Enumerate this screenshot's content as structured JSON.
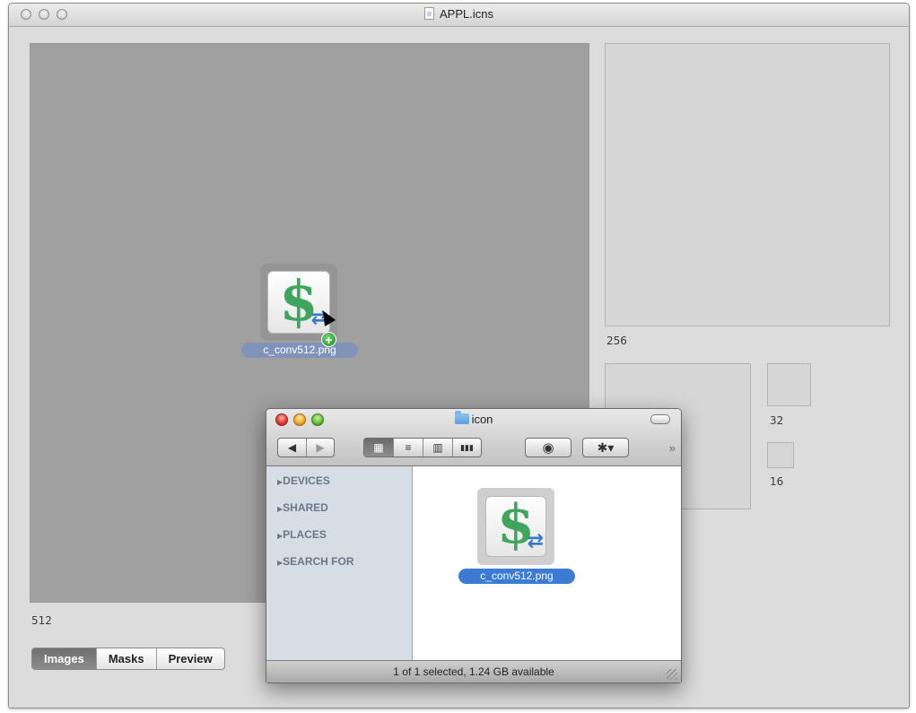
{
  "window": {
    "title": "APPL.icns"
  },
  "wells": {
    "labels": {
      "s512": "512",
      "s256": "256",
      "s32": "32",
      "s16": "16"
    }
  },
  "drag": {
    "filename": "c_conv512.png"
  },
  "tabs": [
    {
      "label": "Images",
      "active": true
    },
    {
      "label": "Masks",
      "active": false
    },
    {
      "label": "Preview",
      "active": false
    }
  ],
  "finder": {
    "title": "icon",
    "sidebar": {
      "devices": "DEVICES",
      "shared": "SHARED",
      "places": "PLACES",
      "search_for": "SEARCH FOR"
    },
    "item_label": "c_conv512.png",
    "status": "1 of 1 selected, 1.24 GB available"
  },
  "icons": {
    "disclosure": "▶",
    "back": "◀",
    "forward": "▶",
    "view_icon": "▦",
    "view_list": "≡",
    "view_column": "▥",
    "view_coverflow": "▮▮▮",
    "quicklook": "◉",
    "action_gear": "✱▾",
    "overflow": "»",
    "dollar": "$",
    "arrows": "⇄",
    "plus": "+"
  }
}
